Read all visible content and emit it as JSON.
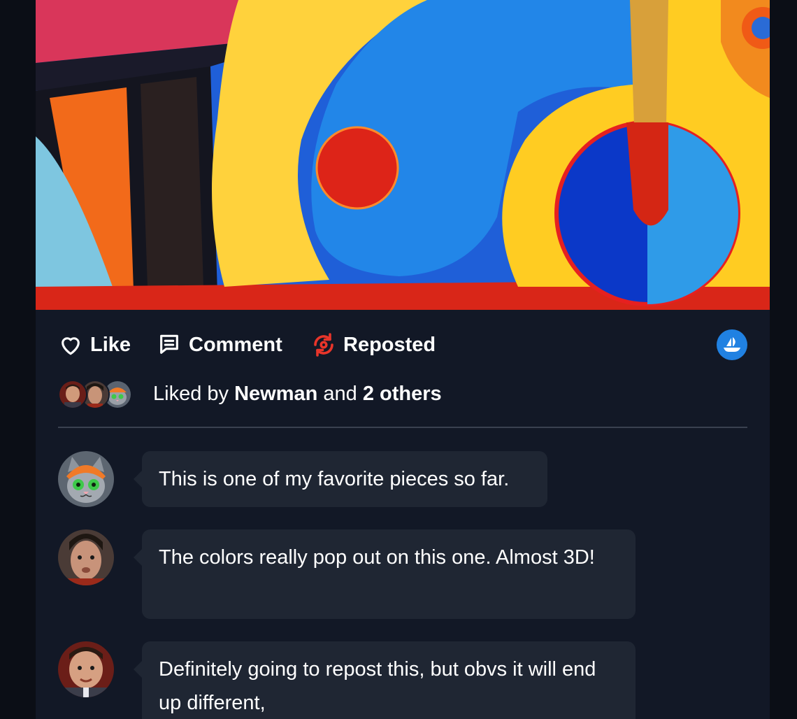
{
  "post": {
    "image_alt": "Abstract colorful artwork",
    "actions": {
      "like_label": "Like",
      "comment_label": "Comment",
      "repost_label": "Reposted",
      "repost_active": true,
      "opensea_icon": "opensea-icon"
    },
    "likes": {
      "prefix": "Liked by",
      "name": "Newman",
      "joiner": "and",
      "others": "2 others",
      "avatars": [
        "newman-avatar",
        "kramer-avatar",
        "cat-avatar"
      ]
    }
  },
  "comments": [
    {
      "avatar": "cat-avatar",
      "text": "This is one of my favorite pieces so far."
    },
    {
      "avatar": "kramer-avatar",
      "text": "The colors really pop out on this one. Almost 3D!"
    },
    {
      "avatar": "newman-avatar",
      "text": "Definitely going to repost this, but obvs it will end up different,"
    }
  ],
  "colors": {
    "background": "#0b0e16",
    "card": "#121826",
    "bubble": "#1f2633",
    "repost_accent": "#e8352a",
    "opensea_blue": "#2081e2"
  }
}
